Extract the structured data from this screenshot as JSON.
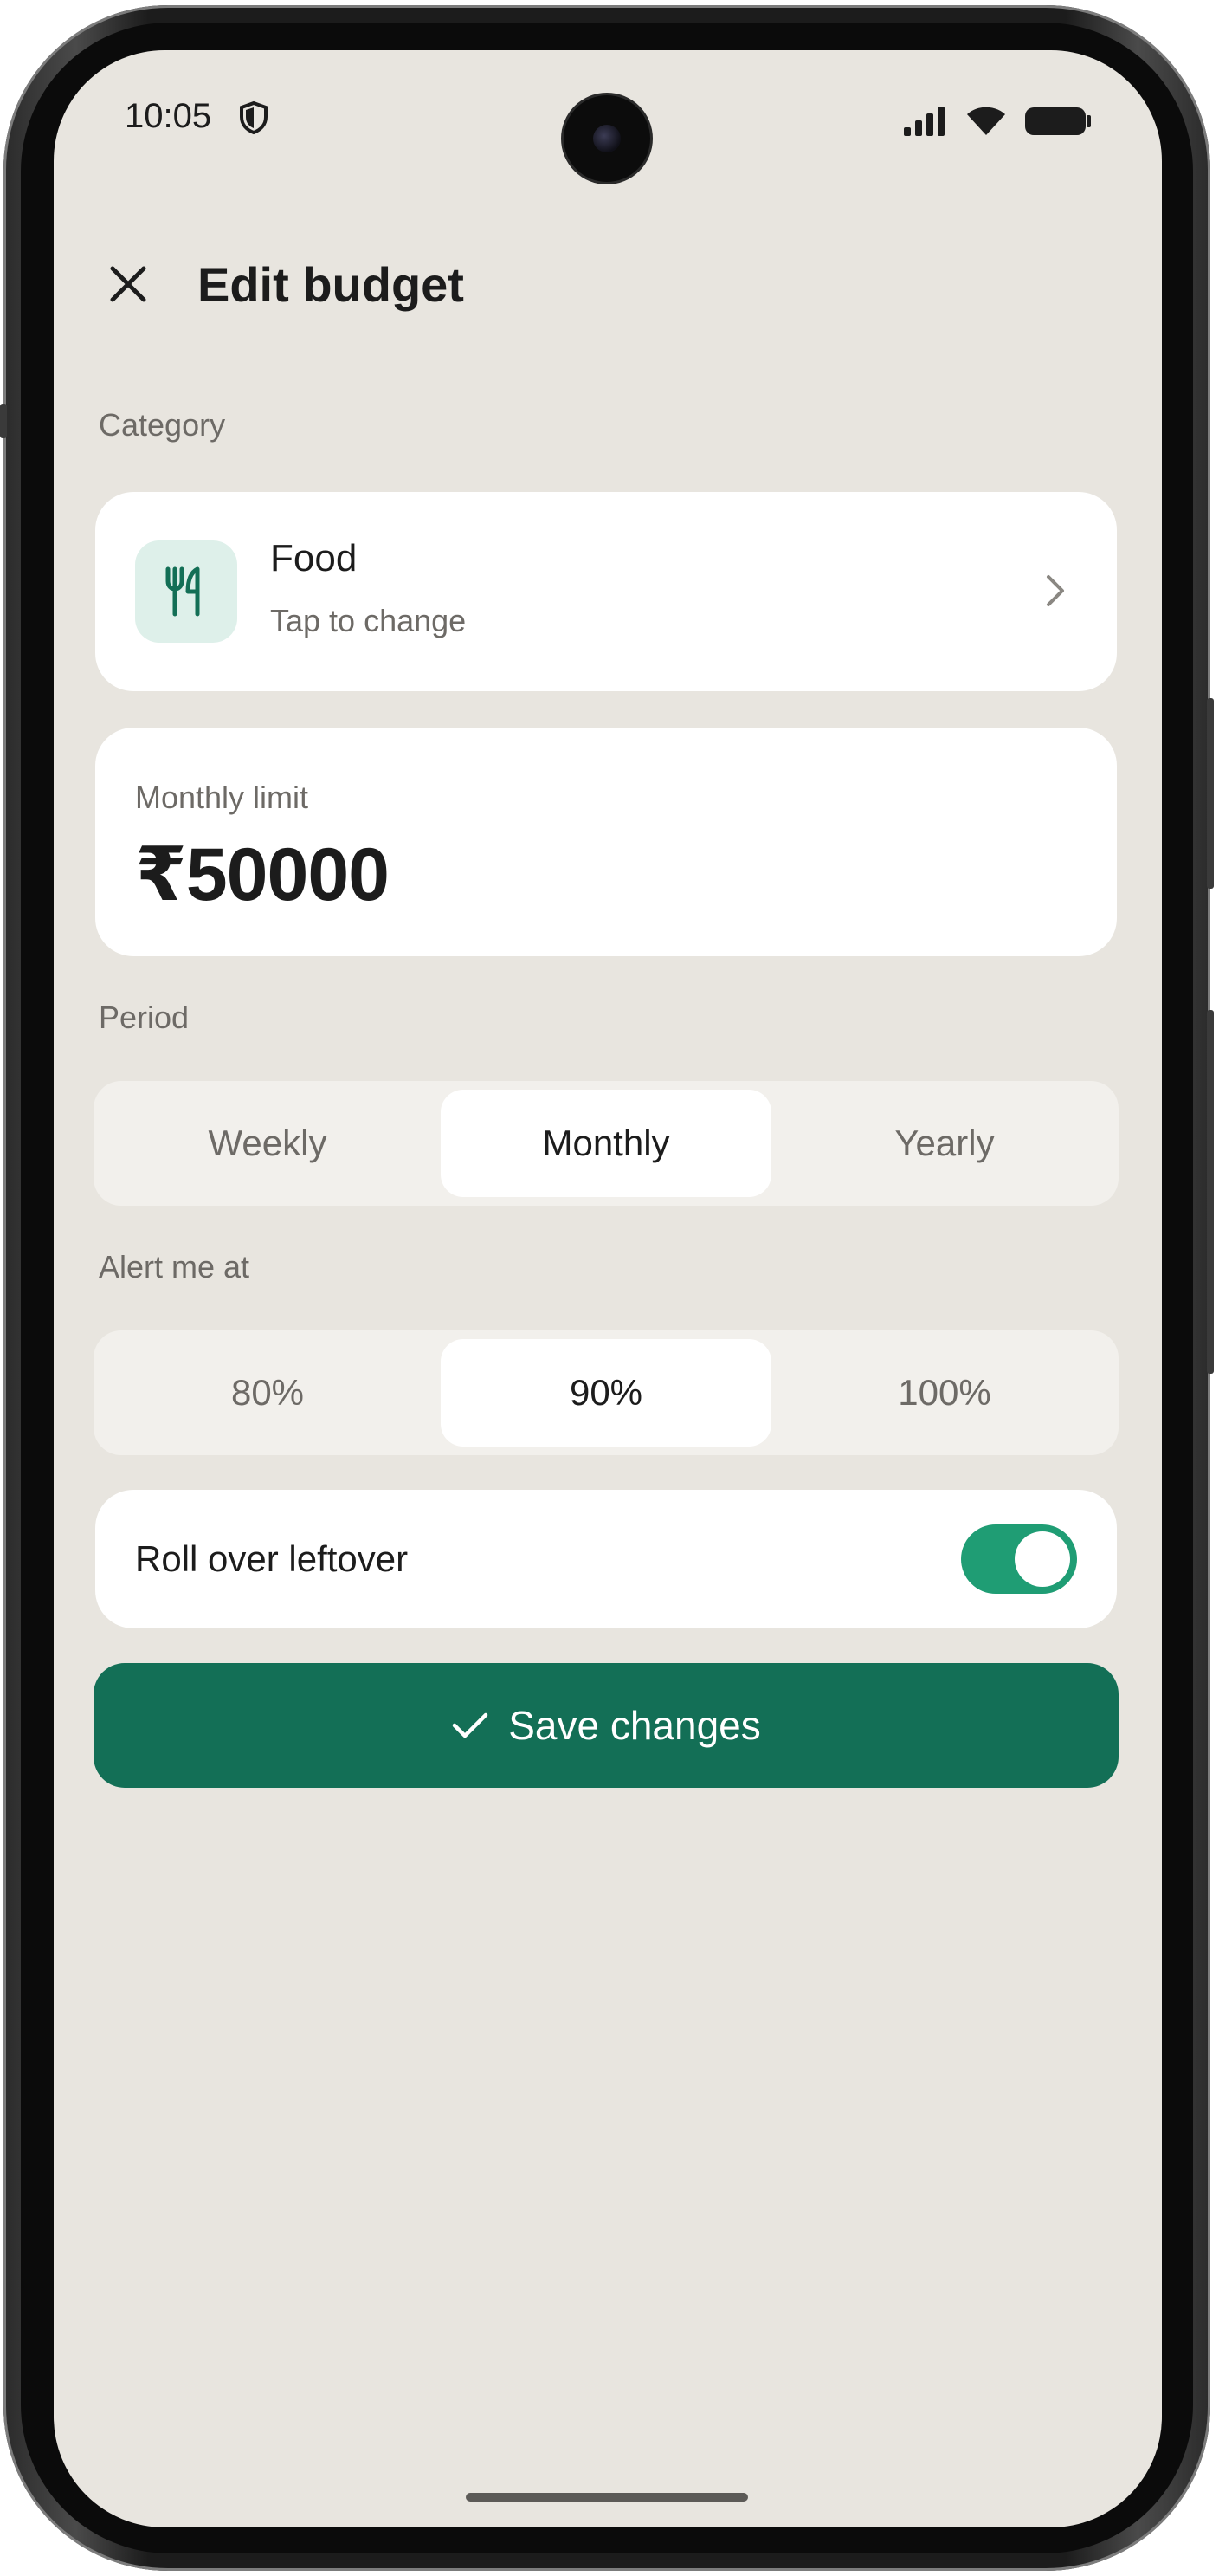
{
  "status_bar": {
    "time": "10:05"
  },
  "header": {
    "title": "Edit budget",
    "close_icon": "close-icon"
  },
  "category": {
    "section_label": "Category",
    "name": "Food",
    "subtitle": "Tap to change",
    "icon": "fork-knife-icon"
  },
  "limit": {
    "label": "Monthly limit",
    "value": "₹50000"
  },
  "period": {
    "section_label": "Period",
    "options": [
      "Weekly",
      "Monthly",
      "Yearly"
    ],
    "selected": "Monthly"
  },
  "alert": {
    "section_label": "Alert me at",
    "options": [
      "80%",
      "90%",
      "100%"
    ],
    "selected": "90%"
  },
  "rollover": {
    "label": "Roll over leftover",
    "enabled": true
  },
  "save": {
    "label": "Save changes",
    "icon": "check-icon"
  },
  "colors": {
    "background": "#e8e5df",
    "card": "#ffffff",
    "accent": "#136f56",
    "toggle_on": "#1f9d74",
    "icon_tint_bg": "#def0ea"
  }
}
